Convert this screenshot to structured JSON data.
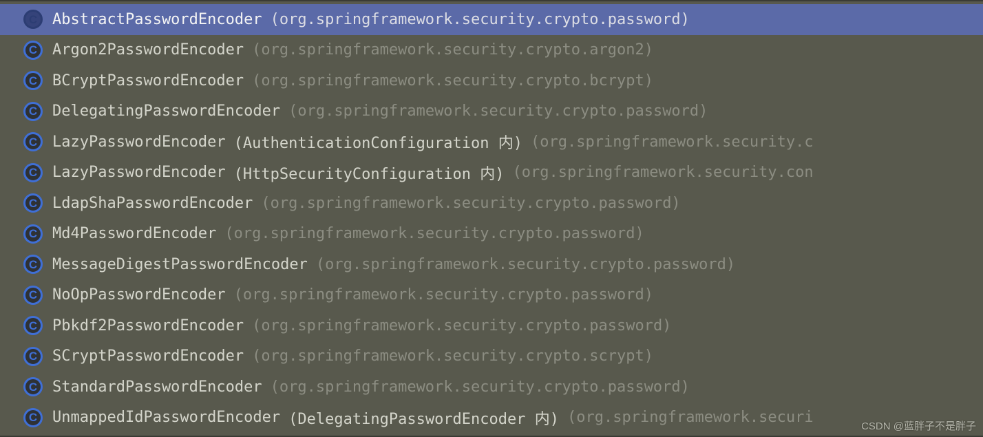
{
  "items": [
    {
      "icon": "C",
      "name": "AbstractPasswordEncoder",
      "qualifier": "",
      "pkg": "(org.springframework.security.crypto.password)",
      "selected": true
    },
    {
      "icon": "C",
      "name": "Argon2PasswordEncoder",
      "qualifier": "",
      "pkg": "(org.springframework.security.crypto.argon2)",
      "selected": false
    },
    {
      "icon": "C",
      "name": "BCryptPasswordEncoder",
      "qualifier": "",
      "pkg": "(org.springframework.security.crypto.bcrypt)",
      "selected": false
    },
    {
      "icon": "C",
      "name": "DelegatingPasswordEncoder",
      "qualifier": "",
      "pkg": "(org.springframework.security.crypto.password)",
      "selected": false
    },
    {
      "icon": "C",
      "name": "LazyPasswordEncoder",
      "qualifier": "(AuthenticationConfiguration 内)",
      "pkg": "(org.springframework.security.c",
      "selected": false
    },
    {
      "icon": "C",
      "name": "LazyPasswordEncoder",
      "qualifier": "(HttpSecurityConfiguration 内)",
      "pkg": "(org.springframework.security.con",
      "selected": false
    },
    {
      "icon": "C",
      "name": "LdapShaPasswordEncoder",
      "qualifier": "",
      "pkg": "(org.springframework.security.crypto.password)",
      "selected": false
    },
    {
      "icon": "C",
      "name": "Md4PasswordEncoder",
      "qualifier": "",
      "pkg": "(org.springframework.security.crypto.password)",
      "selected": false
    },
    {
      "icon": "C",
      "name": "MessageDigestPasswordEncoder",
      "qualifier": "",
      "pkg": "(org.springframework.security.crypto.password)",
      "selected": false
    },
    {
      "icon": "C",
      "name": "NoOpPasswordEncoder",
      "qualifier": "",
      "pkg": "(org.springframework.security.crypto.password)",
      "selected": false
    },
    {
      "icon": "C",
      "name": "Pbkdf2PasswordEncoder",
      "qualifier": "",
      "pkg": "(org.springframework.security.crypto.password)",
      "selected": false
    },
    {
      "icon": "C",
      "name": "SCryptPasswordEncoder",
      "qualifier": "",
      "pkg": "(org.springframework.security.crypto.scrypt)",
      "selected": false
    },
    {
      "icon": "C",
      "name": "StandardPasswordEncoder",
      "qualifier": "",
      "pkg": "(org.springframework.security.crypto.password)",
      "selected": false
    },
    {
      "icon": "C",
      "name": "UnmappedIdPasswordEncoder",
      "qualifier": "(DelegatingPasswordEncoder 内)",
      "pkg": "(org.springframework.securi",
      "selected": false
    }
  ],
  "watermark": "CSDN @蓝胖子不是胖子"
}
